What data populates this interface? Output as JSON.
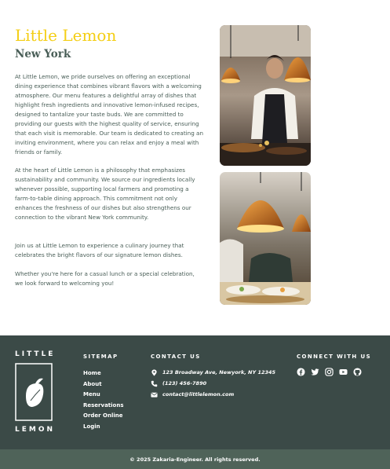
{
  "about": {
    "title": "Little Lemon",
    "subtitle": "New York",
    "paragraphs": [
      "At Little Lemon, we pride ourselves on offering an exceptional dining experience that combines vibrant flavors with a welcoming atmosphere. Our menu features a delightful array of dishes that highlight fresh ingredients and innovative lemon-infused recipes, designed to tantalize your taste buds. We are committed to providing our guests with the highest quality of service, ensuring that each visit is memorable. Our team is dedicated to creating an inviting environment, where you can relax and enjoy a meal with friends or family.",
      "At the heart of Little Lemon is a philosophy that emphasizes sustainability and community. We source our ingredients locally whenever possible, supporting local farmers and promoting a farm-to-table dining approach. This commitment not only enhances the freshness of our dishes but also strengthens our connection to the vibrant New York community.",
      "Join us at Little Lemon to experience a culinary journey that celebrates the bright flavors of our signature lemon dishes.",
      "Whether you're here for a casual lunch or a special celebration, we look forward to welcoming you!"
    ],
    "photos": [
      "chef-photo-1",
      "chef-photo-2"
    ]
  },
  "footer": {
    "logo": {
      "top": "LITTLE",
      "bottom": "LEMON"
    },
    "sitemap": {
      "heading": "SITEMAP",
      "links": [
        "Home",
        "About",
        "Menu",
        "Reservations",
        "Order Online",
        "Login"
      ]
    },
    "contact": {
      "heading": "CONTACT US",
      "address": "123 Broadway Ave, Newyork, NY 12345",
      "phone": "(123) 456-7890",
      "email": "contact@littlelemon.com"
    },
    "connect": {
      "heading": "CONNECT WITH US",
      "icons": [
        "facebook-icon",
        "twitter-icon",
        "instagram-icon",
        "youtube-icon",
        "github-icon"
      ]
    },
    "copyright": "© 2025 Zakaria-Engineer. All rights reserved."
  },
  "colors": {
    "primary_yellow": "#F4CE14",
    "primary_green": "#495E57",
    "footer_bg": "#3B4A47",
    "bottom_bar_bg": "#4F6359"
  }
}
